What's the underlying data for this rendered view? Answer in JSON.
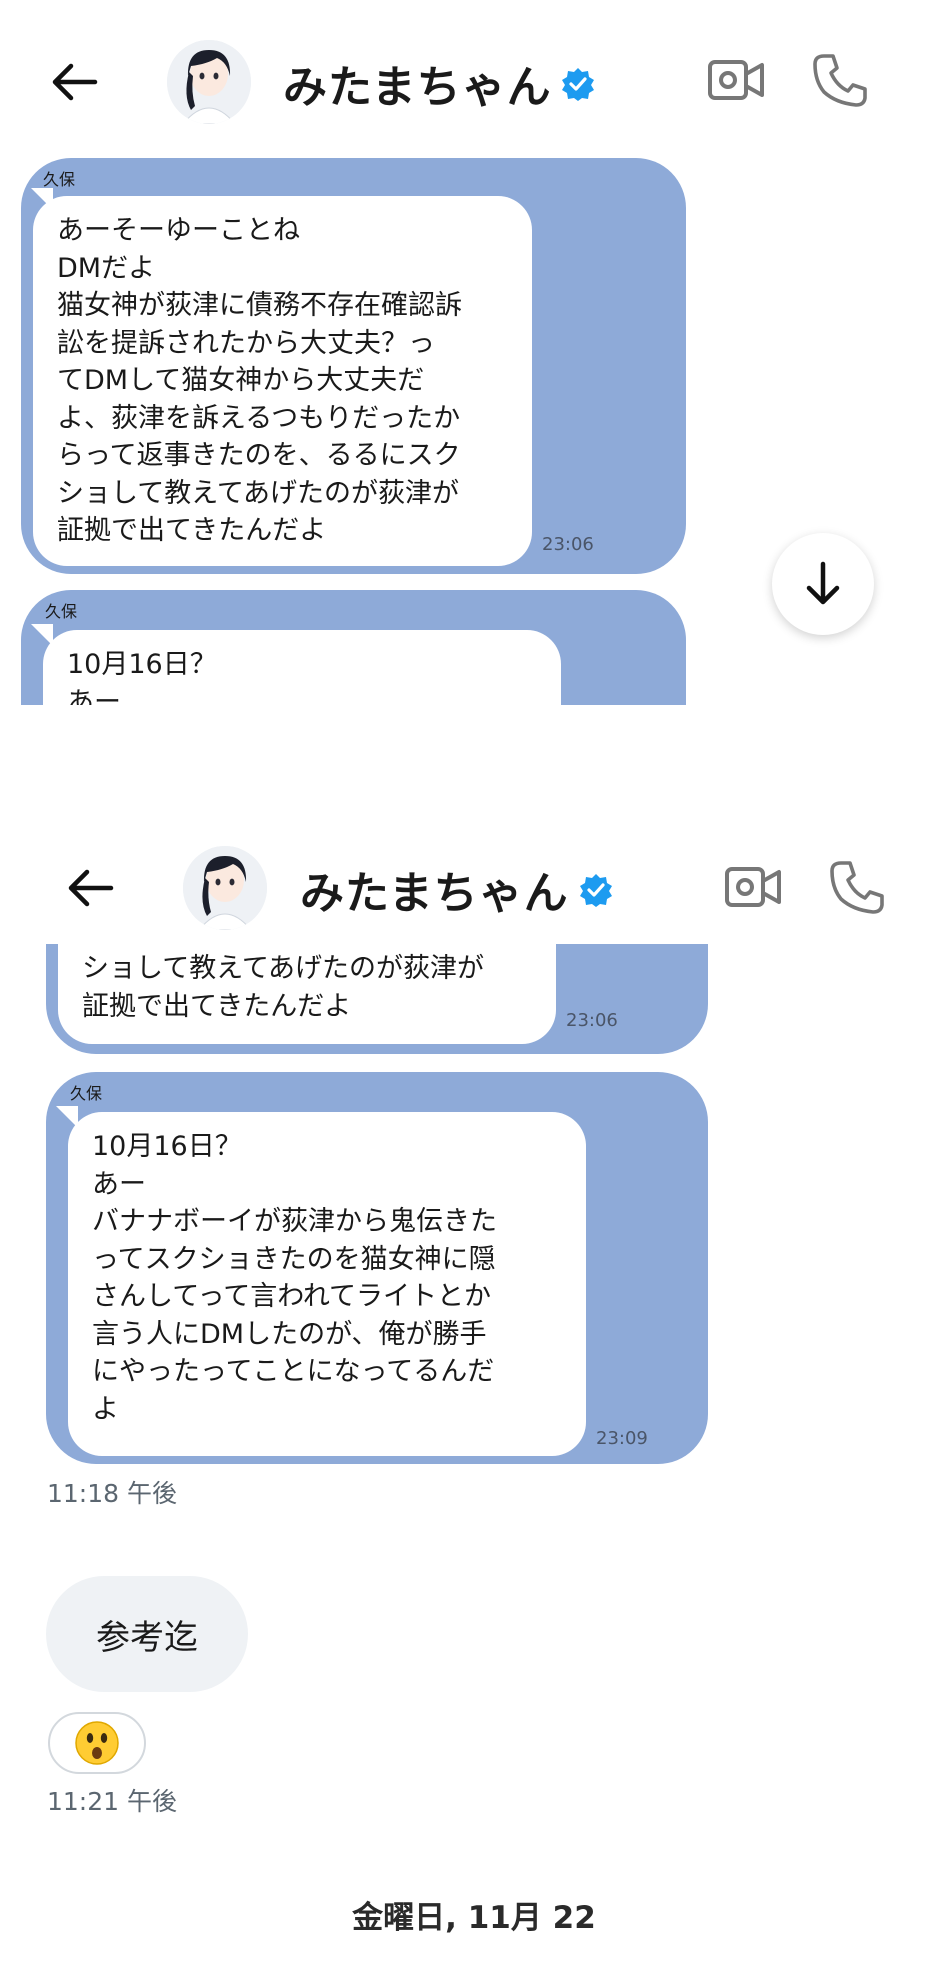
{
  "header": {
    "title": "みたまちゃん"
  },
  "panel1": {
    "quote1": {
      "sender": "久保",
      "text": "あーそーゆーことね\nDMだよ\n猫女神が荻津に債務不存在確認訴\n訟を提訴されたから大丈夫？っ\nてDMして猫女神から大丈夫だ\nよ、荻津を訴えるつもりだったか\nらって返事きたのを、るるにスク\nショして教えてあげたのが荻津が\n証拠で出てきたんだよ",
      "time": "23:06"
    },
    "quote2": {
      "sender": "久保",
      "text": "10月16日？\nあー"
    }
  },
  "panel2": {
    "quote1": {
      "text": "ショして教えてあげたのが荻津が\n証拠で出てきたんだよ",
      "time": "23:06"
    },
    "quote2": {
      "sender": "久保",
      "text": "10月16日？\nあー\nバナナボーイが荻津から鬼伝きた\nってスクショきたのを猫女神に隠\nさんしてって言われてライトとか\n言う人にDMしたのが、俺が勝手\nにやったってことになってるんだ\nよ",
      "time": "23:09"
    },
    "timestamp1": "11:18 午後",
    "message": "参考迄",
    "reaction": "😲",
    "timestamp2": "11:21 午後",
    "day_separator": "金曜日, 11月 22"
  }
}
